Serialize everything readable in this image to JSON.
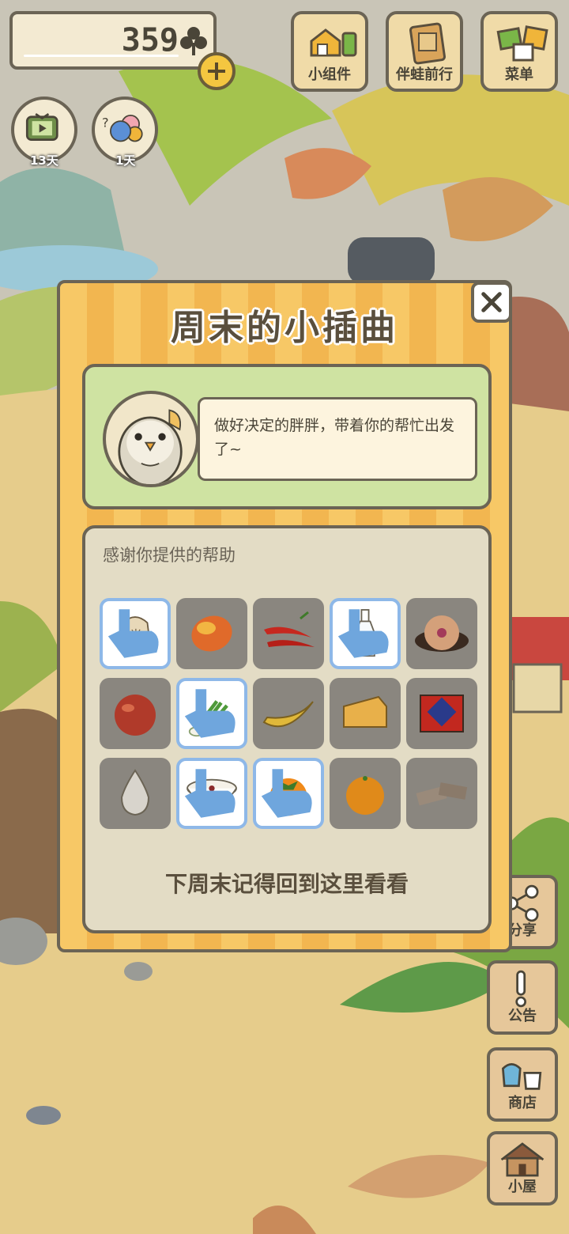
{
  "hud": {
    "clover_count": "359",
    "top_buttons": [
      {
        "label": "小组件",
        "icon": "widget-icon"
      },
      {
        "label": "伴蛙前行",
        "icon": "journal-icon"
      },
      {
        "label": "菜单",
        "icon": "menu-cards-icon"
      }
    ],
    "round_buttons": [
      {
        "days": "13天",
        "icon": "tv-icon"
      },
      {
        "days": "1天",
        "icon": "visitors-icon"
      }
    ],
    "side_buttons": [
      {
        "label": "分享",
        "icon": "share-icon"
      },
      {
        "label": "公告",
        "icon": "notice-icon"
      },
      {
        "label": "商店",
        "icon": "shop-icon"
      },
      {
        "label": "小屋",
        "icon": "house-icon"
      }
    ]
  },
  "dialog": {
    "title": "周末的小插曲",
    "message": "做好决定的胖胖，带着你的帮忙出发了~",
    "help_title": "感谢你提供的帮助",
    "footer": "下周末记得回到这里看看",
    "items": [
      {
        "name": "rice-bag",
        "selected": true
      },
      {
        "name": "mango",
        "selected": false
      },
      {
        "name": "chili-peppers",
        "selected": false
      },
      {
        "name": "glass-bottle",
        "selected": true
      },
      {
        "name": "mooncake",
        "selected": false
      },
      {
        "name": "peach",
        "selected": false
      },
      {
        "name": "scallions",
        "selected": true
      },
      {
        "name": "banana",
        "selected": false
      },
      {
        "name": "cheese",
        "selected": false
      },
      {
        "name": "gift-box",
        "selected": false
      },
      {
        "name": "garlic",
        "selected": false
      },
      {
        "name": "porridge-bowl",
        "selected": true
      },
      {
        "name": "persimmon",
        "selected": true
      },
      {
        "name": "orange",
        "selected": false
      },
      {
        "name": "rice-cakes",
        "selected": false
      }
    ]
  },
  "colors": {
    "dialog_stripe_a": "#f7c866",
    "dialog_stripe_b": "#f2b650",
    "story_panel": "#cfe3a2",
    "help_panel": "#e3dcc5",
    "selected_border": "#8eb8e8",
    "outline": "#6b6455"
  }
}
